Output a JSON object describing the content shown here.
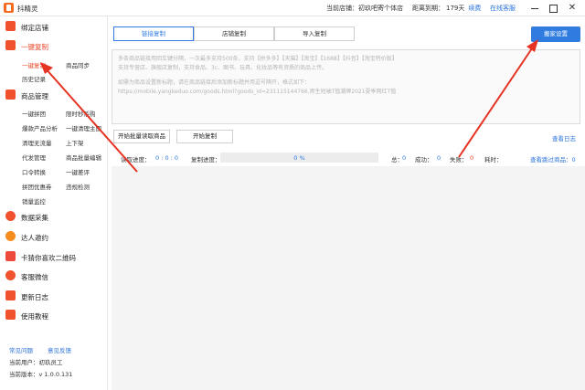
{
  "app": {
    "title": "抖精灵"
  },
  "header": {
    "current_store": "当前店铺：初玖吧寄个体店",
    "expiry_label": "距离到期：",
    "expiry_days": "179天",
    "renew": "续费",
    "online_service": "在线客服"
  },
  "sidebar": {
    "sections": [
      {
        "label": "绑定店铺"
      },
      {
        "label": "一键复制"
      },
      {
        "label": "商品管理"
      },
      {
        "label": "数据采集"
      },
      {
        "label": "达人邀约"
      },
      {
        "label": "卡猜你喜欢二维码"
      },
      {
        "label": "客服微信"
      },
      {
        "label": "更新日志"
      },
      {
        "label": "使用教程"
      }
    ],
    "copy_subitems": [
      "一键复制",
      "商品同步",
      "历史记录"
    ],
    "manage_subitems": [
      "一键拼团",
      "限时秒杀购",
      "爆款产品分析",
      "一键清理主图",
      "清理无流量",
      "上下架",
      "代发管理",
      "商品批量编辑",
      "口令转换",
      "一键差评",
      "拼团优惠券",
      "违规检测",
      "销量监控"
    ],
    "footer": {
      "faq": "常见问题",
      "feedback": "意见反馈",
      "user": "当前用户：初玖员工",
      "version": "当前版本：v 1.0.0.131"
    }
  },
  "main": {
    "tabs": [
      "链接复制",
      "店铺复制",
      "导入复制"
    ],
    "move_setting": "搬家设置",
    "placeholder_lines": [
      "多条商品链接用回车键分隔，一次最多支持500条，支持【拼多多】【天猫】【淘宝】【1688】【抖音】【淘宝特价版】",
      "支持专营店、旗舰店复制，支持食品、3c、图书、玩具、化妆品等有资质的商品上传。",
      "",
      "如需为商品设置新标题，请在商品链接后添加新标题并用逗号隔开，格式如下：",
      "https://mobile.yangkeduo.com/goods.html?goods_id=231115144766,男生短袖T恤潮牌2021夏季网红T恤"
    ],
    "buttons": {
      "batch_read": "开始批量读取商品",
      "start_copy": "开始复制",
      "view_log": "查看日志"
    },
    "progress": {
      "read_label": "读取进度：",
      "read_value": "0 : 0 : 0",
      "copy_label": "复制进度：",
      "percent": "0 %",
      "fraction": 0,
      "total_label": "总：",
      "total": "0",
      "success_label": "成功：",
      "success": "0",
      "fail_label": "失败：",
      "fail": "0",
      "time_label": "耗时：",
      "skipped": "查看跳过商品：0"
    }
  },
  "colors": {
    "accent": "#2f7be0",
    "brand": "#f26b21",
    "active_nav": "#e8482a",
    "annotation_arrow": "#e53222"
  }
}
